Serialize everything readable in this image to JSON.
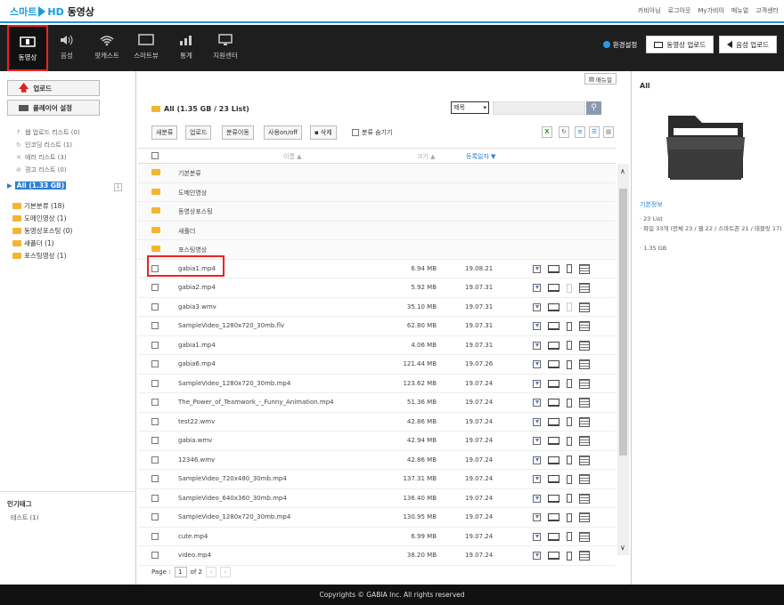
{
  "logo": {
    "part1": "스마트",
    "part2": "HD",
    "part3": "동영상"
  },
  "toplinks": [
    "카비아님",
    "로그아웃",
    "My가비아",
    "매뉴얼",
    "고객센터"
  ],
  "nav": {
    "items": [
      {
        "label": "동영상"
      },
      {
        "label": "음성"
      },
      {
        "label": "팟캐스트"
      },
      {
        "label": "스마트뷰"
      },
      {
        "label": "통계"
      },
      {
        "label": "지원센터"
      }
    ],
    "settings": "환경설정",
    "upload_video": "동영상 업로드",
    "upload_audio": "음성 업로드"
  },
  "left": {
    "upload": "업로드",
    "player_settings": "플레이어 설정",
    "services": [
      "웹 업로드 리스트 (0)",
      "인코딩 리스트 (1)",
      "에러 리스트 (3)",
      "경고 리스트 (0)"
    ],
    "root": "All (1.33 GB)",
    "info": "i",
    "folders": [
      "기본분류 (18)",
      "도메인영상 (1)",
      "동영상포스팅 (0)",
      "새폴더 (1)",
      "포스팅영상 (1)"
    ],
    "tags_title": "인기태그",
    "tags": [
      "테스트 (1)"
    ]
  },
  "main": {
    "help": "매뉴얼",
    "title": "All (1.35 GB / 23 List)",
    "sort": "제목",
    "sort_arrow": "▾",
    "search_icon": "⚲",
    "toolbar": [
      "새분류",
      "업로드",
      "분류이동",
      "사용on/off",
      "삭제"
    ],
    "hide_folders": "분류 숨기기",
    "headers": {
      "name": "이름 ▲",
      "size": "크기 ▲",
      "date": "등록일자 ▼"
    },
    "folders": [
      "기본분류",
      "도메인영상",
      "동영상포스팅",
      "새폴더",
      "포스팅영상"
    ],
    "files": [
      {
        "name": "gabia1.mp4",
        "size": "6.94 MB",
        "date": "19.08.21"
      },
      {
        "name": "gabia2.mp4",
        "size": "5.92 MB",
        "date": "19.07.31"
      },
      {
        "name": "gabia3.wmv",
        "size": "35.10 MB",
        "date": "19.07.31"
      },
      {
        "name": "SampleVideo_1280x720_30mb.flv",
        "size": "62.80 MB",
        "date": "19.07.31"
      },
      {
        "name": "gabia1.mp4",
        "size": "4.06 MB",
        "date": "19.07.31"
      },
      {
        "name": "gabia6.mp4",
        "size": "121.44 MB",
        "date": "19.07.26"
      },
      {
        "name": "SampleVideo_1280x720_30mb.mp4",
        "size": "123.62 MB",
        "date": "19.07.24"
      },
      {
        "name": "The_Power_of_Teamwork_-_Funny_Animation.mp4",
        "size": "51.36 MB",
        "date": "19.07.24"
      },
      {
        "name": "test22.wmv",
        "size": "42.86 MB",
        "date": "19.07.24"
      },
      {
        "name": "gabia.wmv",
        "size": "42.94 MB",
        "date": "19.07.24"
      },
      {
        "name": "12346.wmv",
        "size": "42.86 MB",
        "date": "19.07.24"
      },
      {
        "name": "SampleVideo_720x480_30mb.mp4",
        "size": "137.31 MB",
        "date": "19.07.24"
      },
      {
        "name": "SampleVideo_640x360_30mb.mp4",
        "size": "136.40 MB",
        "date": "19.07.24"
      },
      {
        "name": "SampleVideo_1280x720_30mb.mp4",
        "size": "130.95 MB",
        "date": "19.07.24"
      },
      {
        "name": "cute.mp4",
        "size": "6.99 MB",
        "date": "19.07.24"
      },
      {
        "name": "video.mp4",
        "size": "38.20 MB",
        "date": "19.07.24"
      }
    ],
    "pager": {
      "label": "Page :",
      "page": "1",
      "of": "of 2",
      "prev": "‹",
      "next": "›"
    },
    "scroll_up": "∧",
    "scroll_down": "∨"
  },
  "right": {
    "title": "All",
    "section": "기본정보",
    "lines": [
      "· 23 List",
      "· 파일 33개 (전체 23 / 웹 22 / 스마트폰 21 / 태블릿 17)",
      "· 1.35 GB"
    ]
  },
  "footer": "Copyrights © GABIA Inc. All rights reserved"
}
